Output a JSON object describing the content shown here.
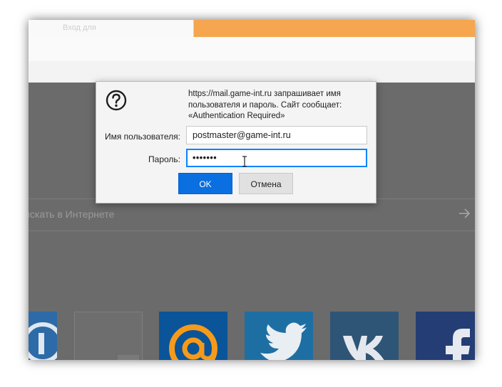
{
  "browser": {
    "active_tab_title": "Вход для",
    "search_placeholder": "искать в Интернете"
  },
  "dialog": {
    "message": "https://mail.game-int.ru запрашивает имя пользователя и пароль. Сайт сообщает: «Authentication Required»",
    "username_label": "Имя пользователя:",
    "username_value": "postmaster@game-int.ru",
    "password_label": "Пароль:",
    "password_value": "•••••••",
    "ok_label": "OK",
    "cancel_label": "Отмена"
  },
  "colors": {
    "accent": "#0a6fe0",
    "focus_border": "#0a84ff",
    "tab_accent": "#f5a64f"
  },
  "tiles": [
    {
      "name": "tile-blue"
    },
    {
      "name": "tile-blank"
    },
    {
      "name": "tile-mailru"
    },
    {
      "name": "tile-twitter"
    },
    {
      "name": "tile-vk"
    },
    {
      "name": "tile-facebook"
    }
  ]
}
